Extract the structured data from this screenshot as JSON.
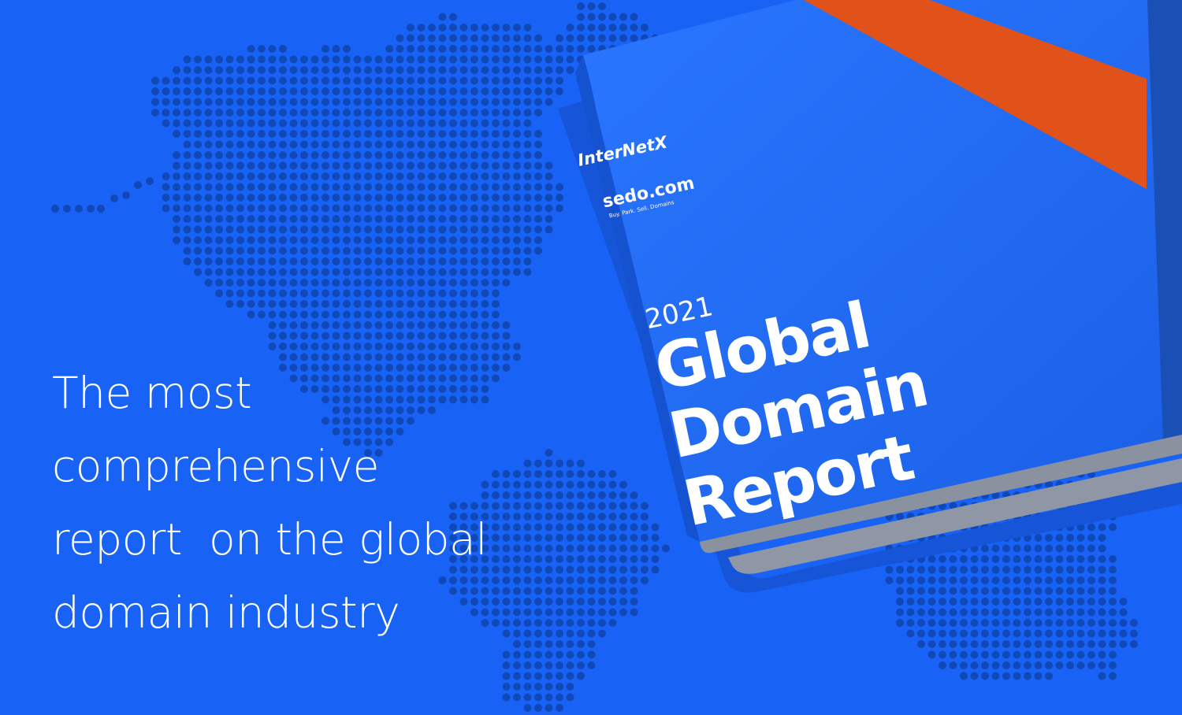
{
  "headline": {
    "lines": [
      "The most",
      "comprehensive",
      "report  on the global",
      "domain industry"
    ]
  },
  "booklet": {
    "brand_primary": "InterNetX",
    "brand_secondary": "sedo.com",
    "brand_secondary_tagline": "Buy. Park. Sell. Domains",
    "year": "2021",
    "title_lines": [
      "Global",
      "Domain",
      "Report"
    ]
  },
  "colors": {
    "background": "#1863f5",
    "map_dot": "#1148b8",
    "cover": "#1f6cf5",
    "cover_stripe": "#e0521a",
    "text": "#ffffff"
  },
  "icons": {
    "pie_in_report_title": "pie-chart-icon"
  }
}
